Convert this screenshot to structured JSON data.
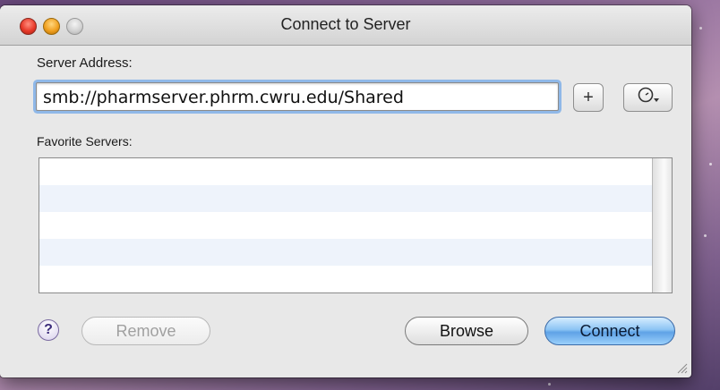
{
  "window": {
    "title": "Connect to Server"
  },
  "server_address": {
    "label": "Server Address:",
    "value": "smb://pharmserver.phrm.cwru.edu/Shared"
  },
  "toolbar": {
    "add_label": "+"
  },
  "favorites": {
    "label": "Favorite Servers:",
    "items": []
  },
  "buttons": {
    "help": "?",
    "remove": "Remove",
    "browse": "Browse",
    "connect": "Connect"
  },
  "colors": {
    "accent": "#8fb8e8",
    "connect_button": "#5fa2e6",
    "close_light": "#e83a2a",
    "minimize_light": "#f0a020"
  }
}
